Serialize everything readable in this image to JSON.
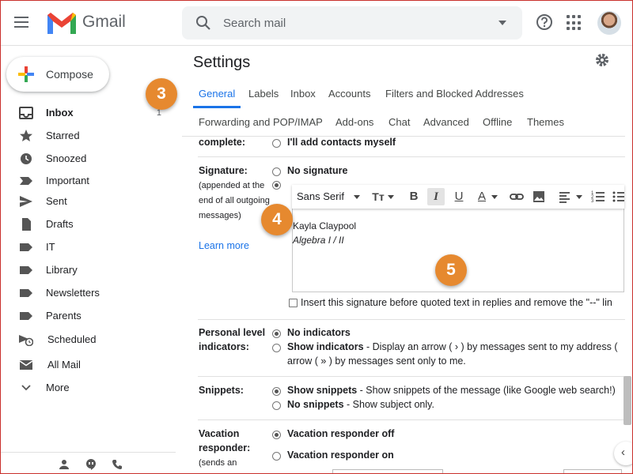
{
  "header": {
    "logo_text": "Gmail",
    "search_placeholder": "Search mail"
  },
  "sidebar": {
    "compose_label": "Compose",
    "items": [
      {
        "label": "Inbox",
        "count": "1",
        "icon": "inbox-icon",
        "bold": true
      },
      {
        "label": "Starred",
        "icon": "star-icon"
      },
      {
        "label": "Snoozed",
        "icon": "clock-icon"
      },
      {
        "label": "Important",
        "icon": "important-icon"
      },
      {
        "label": "Sent",
        "icon": "send-icon"
      },
      {
        "label": "Drafts",
        "icon": "draft-icon"
      },
      {
        "label": "IT",
        "icon": "label-icon"
      },
      {
        "label": "Library",
        "icon": "label-icon"
      },
      {
        "label": "Newsletters",
        "icon": "label-icon"
      },
      {
        "label": "Parents",
        "icon": "label-icon"
      },
      {
        "label": "Scheduled",
        "icon": "scheduled-icon"
      },
      {
        "label": "All Mail",
        "icon": "all-mail-icon"
      },
      {
        "label": "More",
        "icon": "chevron-down-icon"
      }
    ]
  },
  "main": {
    "title": "Settings",
    "tabs": [
      "General",
      "Labels",
      "Inbox",
      "Accounts",
      "Filters and Blocked Addresses",
      "Forwarding and POP/IMAP",
      "Add-ons",
      "Chat",
      "Advanced",
      "Offline",
      "Themes"
    ],
    "active_tab": "General",
    "create_contacts": {
      "label": "complete:",
      "option": "I'll add contacts myself"
    },
    "signature": {
      "label": "Signature:",
      "sub": "(appended at the end of all outgoing messages)",
      "learn_more": "Learn more",
      "no_signature": "No signature",
      "font": "Sans Serif",
      "line1": "Kayla Claypool",
      "line2": "Algebra I / II",
      "insert_before": "Insert this signature before quoted text in replies and remove the \"--\" lin"
    },
    "personal_level": {
      "label1": "Personal level",
      "label2": "indicators:",
      "opt1": "No indicators",
      "opt2_bold": "Show indicators",
      "opt2_rest": " - Display an arrow ( › ) by messages sent to my address (",
      "opt2_line2": "arrow ( » ) by messages sent only to me."
    },
    "snippets": {
      "label": "Snippets:",
      "opt1_bold": "Show snippets",
      "opt1_rest": " - Show snippets of the message (like Google web search!)",
      "opt2_bold": "No snippets",
      "opt2_rest": " - Show subject only."
    },
    "vacation": {
      "label1": "Vacation",
      "label2": "responder:",
      "sub": "(sends an",
      "opt1": "Vacation responder off",
      "opt2": "Vacation responder on"
    }
  },
  "callouts": [
    "3",
    "4",
    "5"
  ],
  "colors": {
    "accent": "#1a73e8",
    "callout": "#e6892f"
  }
}
